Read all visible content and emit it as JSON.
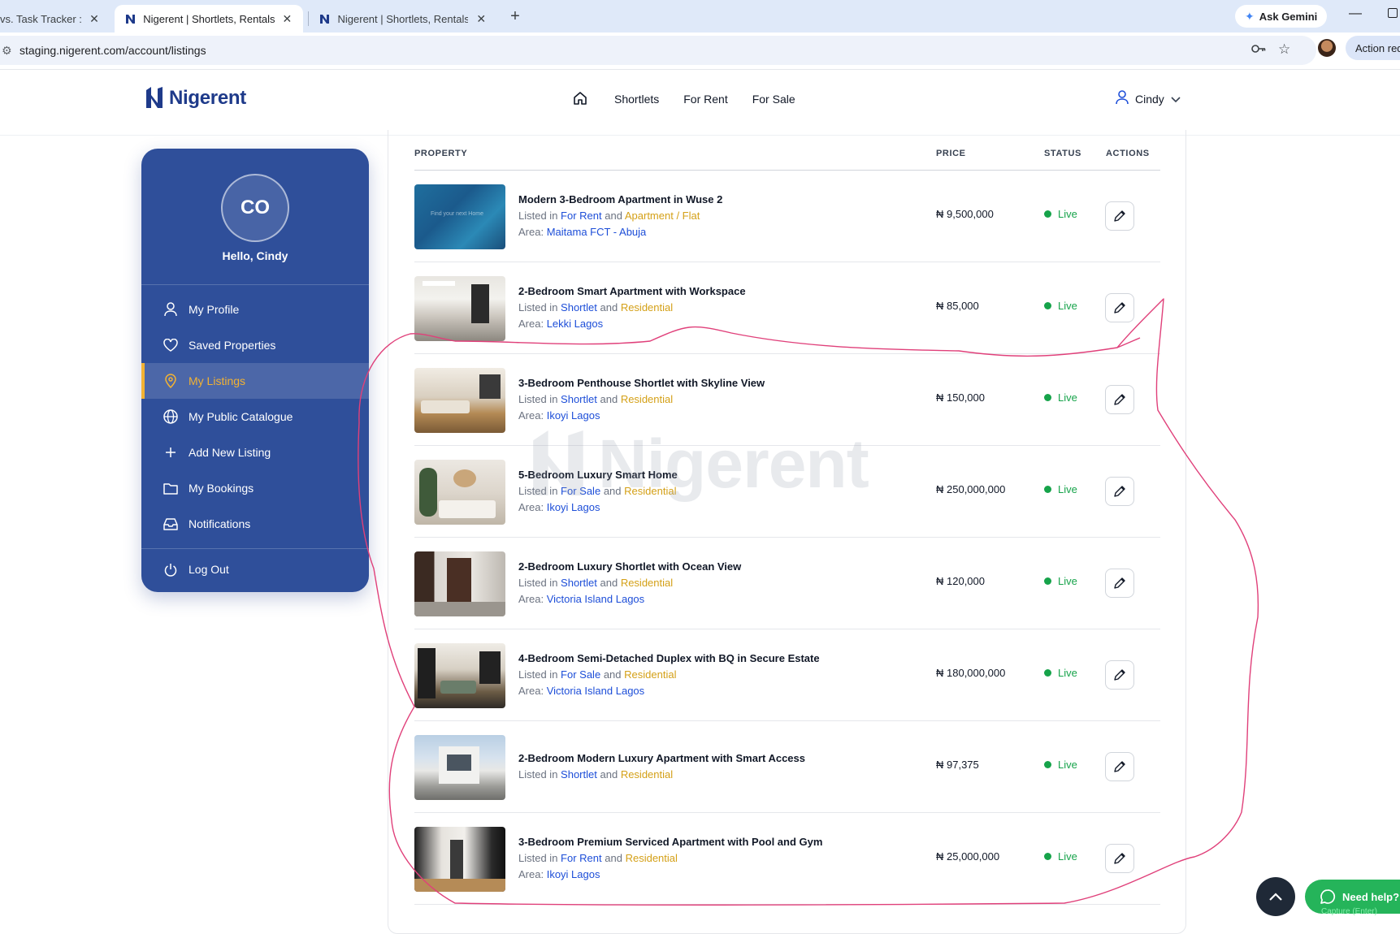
{
  "browser": {
    "tabs": [
      {
        "title": "vs. Task Tracker : \"M",
        "active": false
      },
      {
        "title": "Nigerent | Shortlets, Rentals & I",
        "active": true
      },
      {
        "title": "Nigerent | Shortlets, Rentals & I",
        "active": false
      }
    ],
    "ask_gemini": "Ask Gemini",
    "url": "staging.nigerent.com/account/listings",
    "action_required": "Action requ"
  },
  "header": {
    "logo_text": "Nigerent",
    "nav": [
      "Shortlets",
      "For Rent",
      "For Sale"
    ],
    "user_name": "Cindy"
  },
  "sidebar": {
    "initials": "CO",
    "greeting": "Hello, Cindy",
    "items": [
      {
        "label": "My Profile",
        "icon": "user-icon"
      },
      {
        "label": "Saved Properties",
        "icon": "heart-icon"
      },
      {
        "label": "My Listings",
        "icon": "map-pin-icon",
        "active": true
      },
      {
        "label": "My Public Catalogue",
        "icon": "globe-icon"
      },
      {
        "label": "Add New Listing",
        "icon": "plus-icon"
      },
      {
        "label": "My Bookings",
        "icon": "folder-icon"
      },
      {
        "label": "Notifications",
        "icon": "inbox-icon"
      }
    ],
    "logout": "Log Out"
  },
  "table": {
    "headers": {
      "property": "PROPERTY",
      "price": "PRICE",
      "status": "STATUS",
      "actions": "ACTIONS"
    },
    "rows": [
      {
        "title": "Modern 3-Bedroom Apartment in Wuse 2",
        "listed_prefix": "Listed in",
        "listing_type": "For Rent",
        "and": "and",
        "category": "Apartment / Flat",
        "area_prefix": "Area:",
        "area": "Maitama FCT - Abuja",
        "price": "₦ 9,500,000",
        "status": "Live",
        "thumb_caption": "Find your next Home"
      },
      {
        "title": "2-Bedroom Smart Apartment with Workspace",
        "listed_prefix": "Listed in",
        "listing_type": "Shortlet",
        "and": "and",
        "category": "Residential",
        "area_prefix": "Area:",
        "area": "Lekki Lagos",
        "price": "₦ 85,000",
        "status": "Live"
      },
      {
        "title": "3-Bedroom Penthouse Shortlet with Skyline View",
        "listed_prefix": "Listed in",
        "listing_type": "Shortlet",
        "and": "and",
        "category": "Residential",
        "area_prefix": "Area:",
        "area": "Ikoyi Lagos",
        "price": "₦ 150,000",
        "status": "Live"
      },
      {
        "title": "5-Bedroom Luxury Smart Home",
        "listed_prefix": "Listed in",
        "listing_type": "For Sale",
        "and": "and",
        "category": "Residential",
        "area_prefix": "Area:",
        "area": "Ikoyi Lagos",
        "price": "₦ 250,000,000",
        "status": "Live"
      },
      {
        "title": "2-Bedroom Luxury Shortlet with Ocean View",
        "listed_prefix": "Listed in",
        "listing_type": "Shortlet",
        "and": "and",
        "category": "Residential",
        "area_prefix": "Area:",
        "area": "Victoria Island Lagos",
        "price": "₦ 120,000",
        "status": "Live"
      },
      {
        "title": "4-Bedroom Semi-Detached Duplex with BQ in Secure Estate",
        "listed_prefix": "Listed in",
        "listing_type": "For Sale",
        "and": "and",
        "category": "Residential",
        "area_prefix": "Area:",
        "area": "Victoria Island Lagos",
        "price": "₦ 180,000,000",
        "status": "Live"
      },
      {
        "title": "2-Bedroom Modern Luxury Apartment with Smart Access",
        "listed_prefix": "Listed in",
        "listing_type": "Shortlet",
        "and": "and",
        "category": "Residential",
        "price": "₦ 97,375",
        "status": "Live"
      },
      {
        "title": "3-Bedroom Premium Serviced Apartment with Pool and Gym",
        "listed_prefix": "Listed in",
        "listing_type": "For Rent",
        "and": "and",
        "category": "Residential",
        "area_prefix": "Area:",
        "area": "Ikoyi Lagos",
        "price": "₦ 25,000,000",
        "status": "Live"
      }
    ]
  },
  "watermark": "Nigerent",
  "floating": {
    "need_help": "Need help?",
    "capture_hint": "Capture (Enter)"
  },
  "colors": {
    "brand_blue": "#2f4f9a",
    "accent_gold": "#f2b233",
    "live_green": "#16a34a",
    "annotation_pink": "#e0407a"
  }
}
